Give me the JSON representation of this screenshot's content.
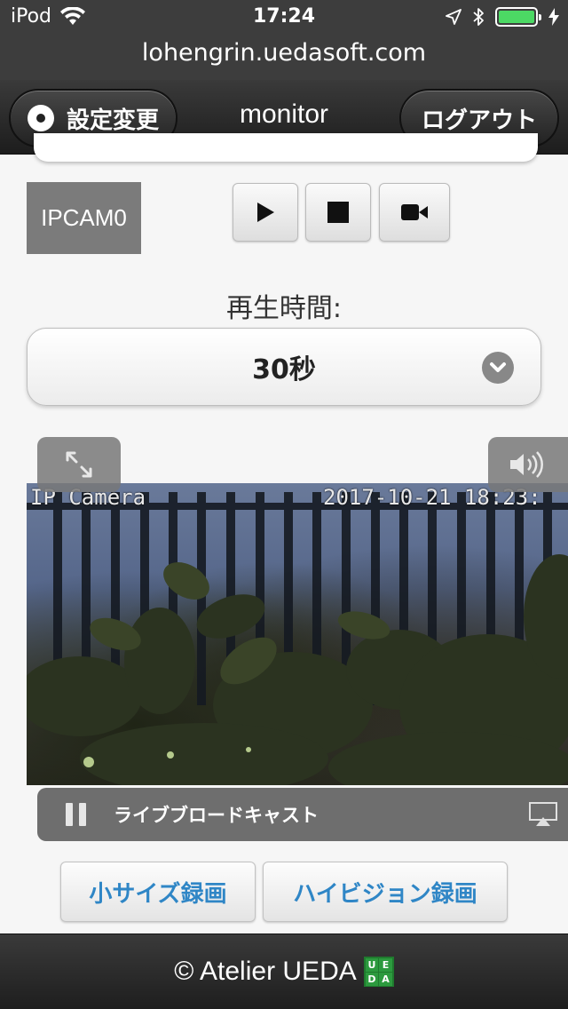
{
  "status_bar": {
    "carrier": "iPod",
    "time": "17:24",
    "battery_level": 1.0,
    "battery_color": "#4cd964"
  },
  "url_bar": {
    "domain": "lohengrin.uedasoft.com"
  },
  "header": {
    "settings_label": "設定変更",
    "title": "monitor",
    "logout_label": "ログアウト"
  },
  "camera": {
    "badge_label": "IPCAM0",
    "controls": [
      {
        "name": "play",
        "icon": "play-icon"
      },
      {
        "name": "stop",
        "icon": "stop-icon"
      },
      {
        "name": "record",
        "icon": "video-camera-icon"
      }
    ]
  },
  "playback": {
    "label": "再生時間:",
    "selected_value": "30秒"
  },
  "video": {
    "overlay_title": "IP Camera",
    "overlay_timestamp": "2017-10-21 18:23:",
    "live_label": "ライブブロードキャスト"
  },
  "record_buttons": {
    "small_label": "小サイズ録画",
    "hd_label": "ハイビジョン録画",
    "color": "#2f86c6"
  },
  "footer": {
    "copyright": "© Atelier UEDA",
    "logo_letters": [
      "U",
      "E",
      "D",
      "A"
    ]
  }
}
